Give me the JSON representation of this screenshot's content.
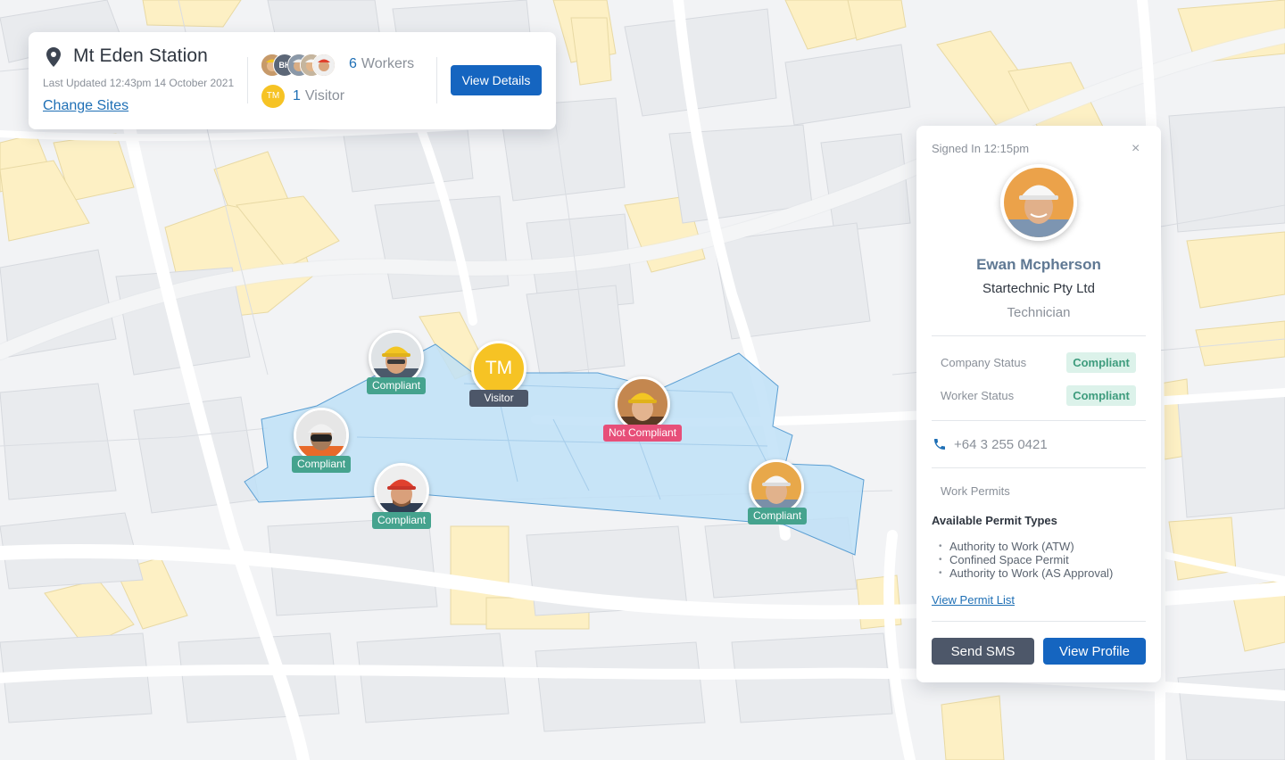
{
  "site": {
    "name": "Mt Eden Station",
    "last_updated": "Last Updated 12:43pm 14 October 2021",
    "change_sites": "Change Sites",
    "workers_count": "6",
    "workers_label": "Workers",
    "visitors_count": "1",
    "visitors_label": "Visitor",
    "visitor_initials": "TM",
    "stack_initials": "BH",
    "view_details": "View Details"
  },
  "map": {
    "markers": [
      {
        "label": "Compliant",
        "status": "compliant"
      },
      {
        "label": "Compliant",
        "status": "compliant"
      },
      {
        "label": "Compliant",
        "status": "compliant"
      },
      {
        "label": "Not Compliant",
        "status": "not-compliant"
      },
      {
        "label": "Compliant",
        "status": "compliant"
      }
    ],
    "visitor_marker": {
      "initials": "TM",
      "label": "Visitor"
    }
  },
  "profile": {
    "signed_in": "Signed In 12:15pm",
    "close": "×",
    "name": "Ewan Mcpherson",
    "company": "Startechnic Pty Ltd",
    "role": "Technician",
    "company_status_label": "Company Status",
    "company_status": "Compliant",
    "worker_status_label": "Worker Status",
    "worker_status": "Compliant",
    "phone": "+64 3 255 0421",
    "work_permits_label": "Work Permits",
    "available_title": "Available Permit Types",
    "permits": [
      "Authority to Work (ATW)",
      "Confined Space Permit",
      "Authority to Work (AS Approval)"
    ],
    "view_permit_list": "View Permit List",
    "send_sms": "Send SMS",
    "view_profile": "View Profile"
  },
  "colors": {
    "primary": "#1565c0",
    "compliant": "#45a38e",
    "not_compliant": "#e74f79",
    "visitor": "#f6c324",
    "dark_button": "#4d5769",
    "site_area": "#bfe0f7"
  },
  "icons": {
    "pin": "location-pin-icon",
    "phone": "phone-icon",
    "close": "close-icon"
  }
}
